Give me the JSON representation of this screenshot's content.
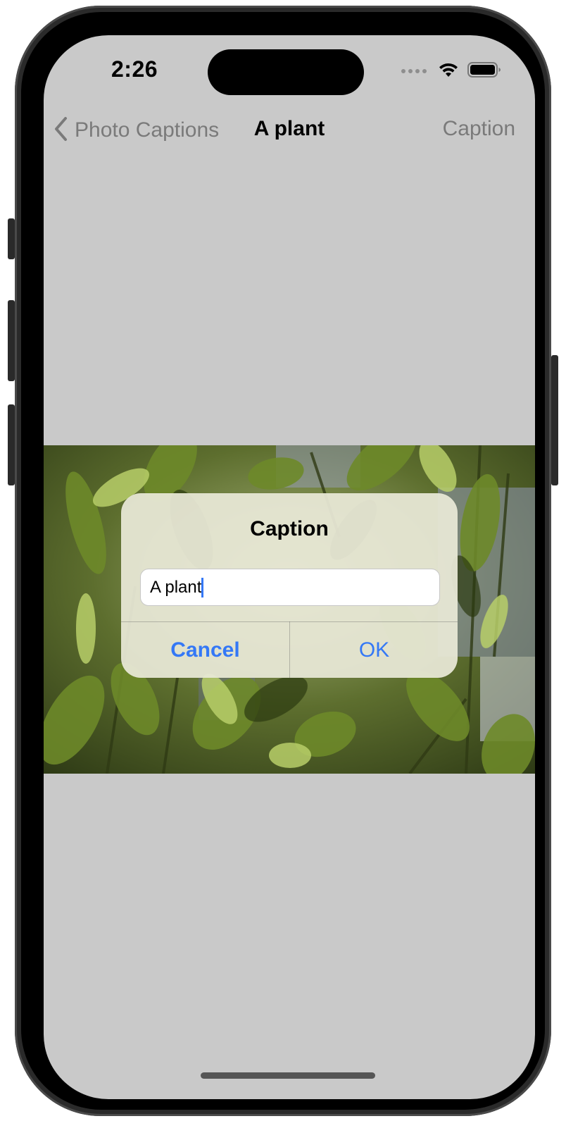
{
  "status_bar": {
    "time": "2:26",
    "wifi_icon": "wifi-icon",
    "battery_icon": "battery-icon"
  },
  "nav_bar": {
    "back_label": "Photo Captions",
    "title": "A plant",
    "right_action": "Caption"
  },
  "photo": {
    "description_icon": "photo-plant-leaves"
  },
  "alert": {
    "title": "Caption",
    "field_value": "A plant",
    "cancel_label": "Cancel",
    "ok_label": "OK"
  },
  "colors": {
    "accent": "#3478f6",
    "background": "#c9c9c9",
    "alert_background": "#e8e8d6"
  }
}
